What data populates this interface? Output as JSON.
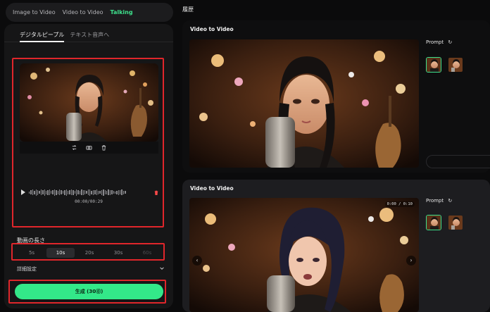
{
  "top_nav": {
    "tabs": [
      "Image to Video",
      "Video to Video",
      "Talking"
    ],
    "active": 2
  },
  "panel": {
    "sub_tabs": [
      "デジタルピープル",
      "テキスト音声へ"
    ],
    "audio": {
      "timecode": "00:00/00:29"
    },
    "length": {
      "label": "動画の長さ",
      "options": [
        "5s",
        "10s",
        "20s",
        "30s",
        "60s"
      ],
      "selected": "10s",
      "disabled": [
        "60s"
      ]
    },
    "advanced": {
      "label": "詳細設定"
    },
    "generate": {
      "label": "生成 (30⓪)"
    }
  },
  "history": {
    "title": "履歴",
    "cards": [
      {
        "title": "Video to Video",
        "prompt_label": "Prompt"
      },
      {
        "title": "Video to Video",
        "prompt_label": "Prompt",
        "video_time": "0:00 / 0:10"
      }
    ]
  },
  "colors": {
    "accent": "#3ee08c",
    "button": "#33e889",
    "highlight": "#e0262b"
  },
  "icons": [
    "refresh-icon",
    "replace-icon",
    "camera-icon",
    "trash-icon",
    "play-icon",
    "chevron-down-icon",
    "arrow-left-icon",
    "arrow-right-icon"
  ]
}
